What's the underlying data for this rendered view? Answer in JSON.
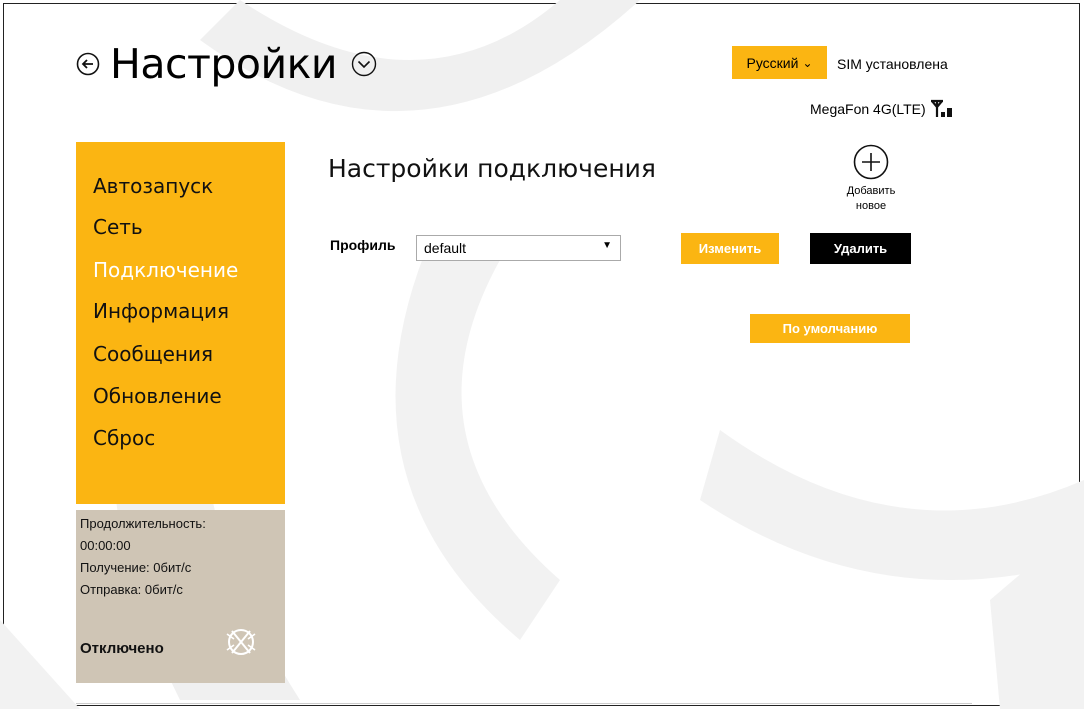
{
  "header": {
    "title": "Настройки",
    "language": "Русский",
    "sim_status": "SIM установлена",
    "network": "MegaFon 4G(LTE)"
  },
  "sidebar": {
    "items": [
      {
        "label": "Автозапуск",
        "active": false
      },
      {
        "label": "Сеть",
        "active": false
      },
      {
        "label": "Подключение",
        "active": true
      },
      {
        "label": "Информация",
        "active": false
      },
      {
        "label": "Сообщения",
        "active": false
      },
      {
        "label": "Обновление",
        "active": false
      },
      {
        "label": "Сброс",
        "active": false
      }
    ]
  },
  "status": {
    "duration_label": "Продолжительность:",
    "duration_value": "00:00:00",
    "receive": "Получение: 0бит/с",
    "send": "Отправка: 0бит/с",
    "connection": "Отключено"
  },
  "main": {
    "section_title": "Настройки подключения",
    "add_new_line1": "Добавить",
    "add_new_line2": "новое",
    "profile_label": "Профиль",
    "profile_value": "default",
    "edit_button": "Изменить",
    "delete_button": "Удалить",
    "default_button": "По умолчанию"
  },
  "colors": {
    "accent": "#fbb512",
    "status_panel": "#cfc5b5",
    "dark_button": "#000000"
  },
  "icons": [
    "back-arrow-icon",
    "chevron-down-icon",
    "signal-icon",
    "add-circle-icon",
    "disconnect-icon"
  ]
}
